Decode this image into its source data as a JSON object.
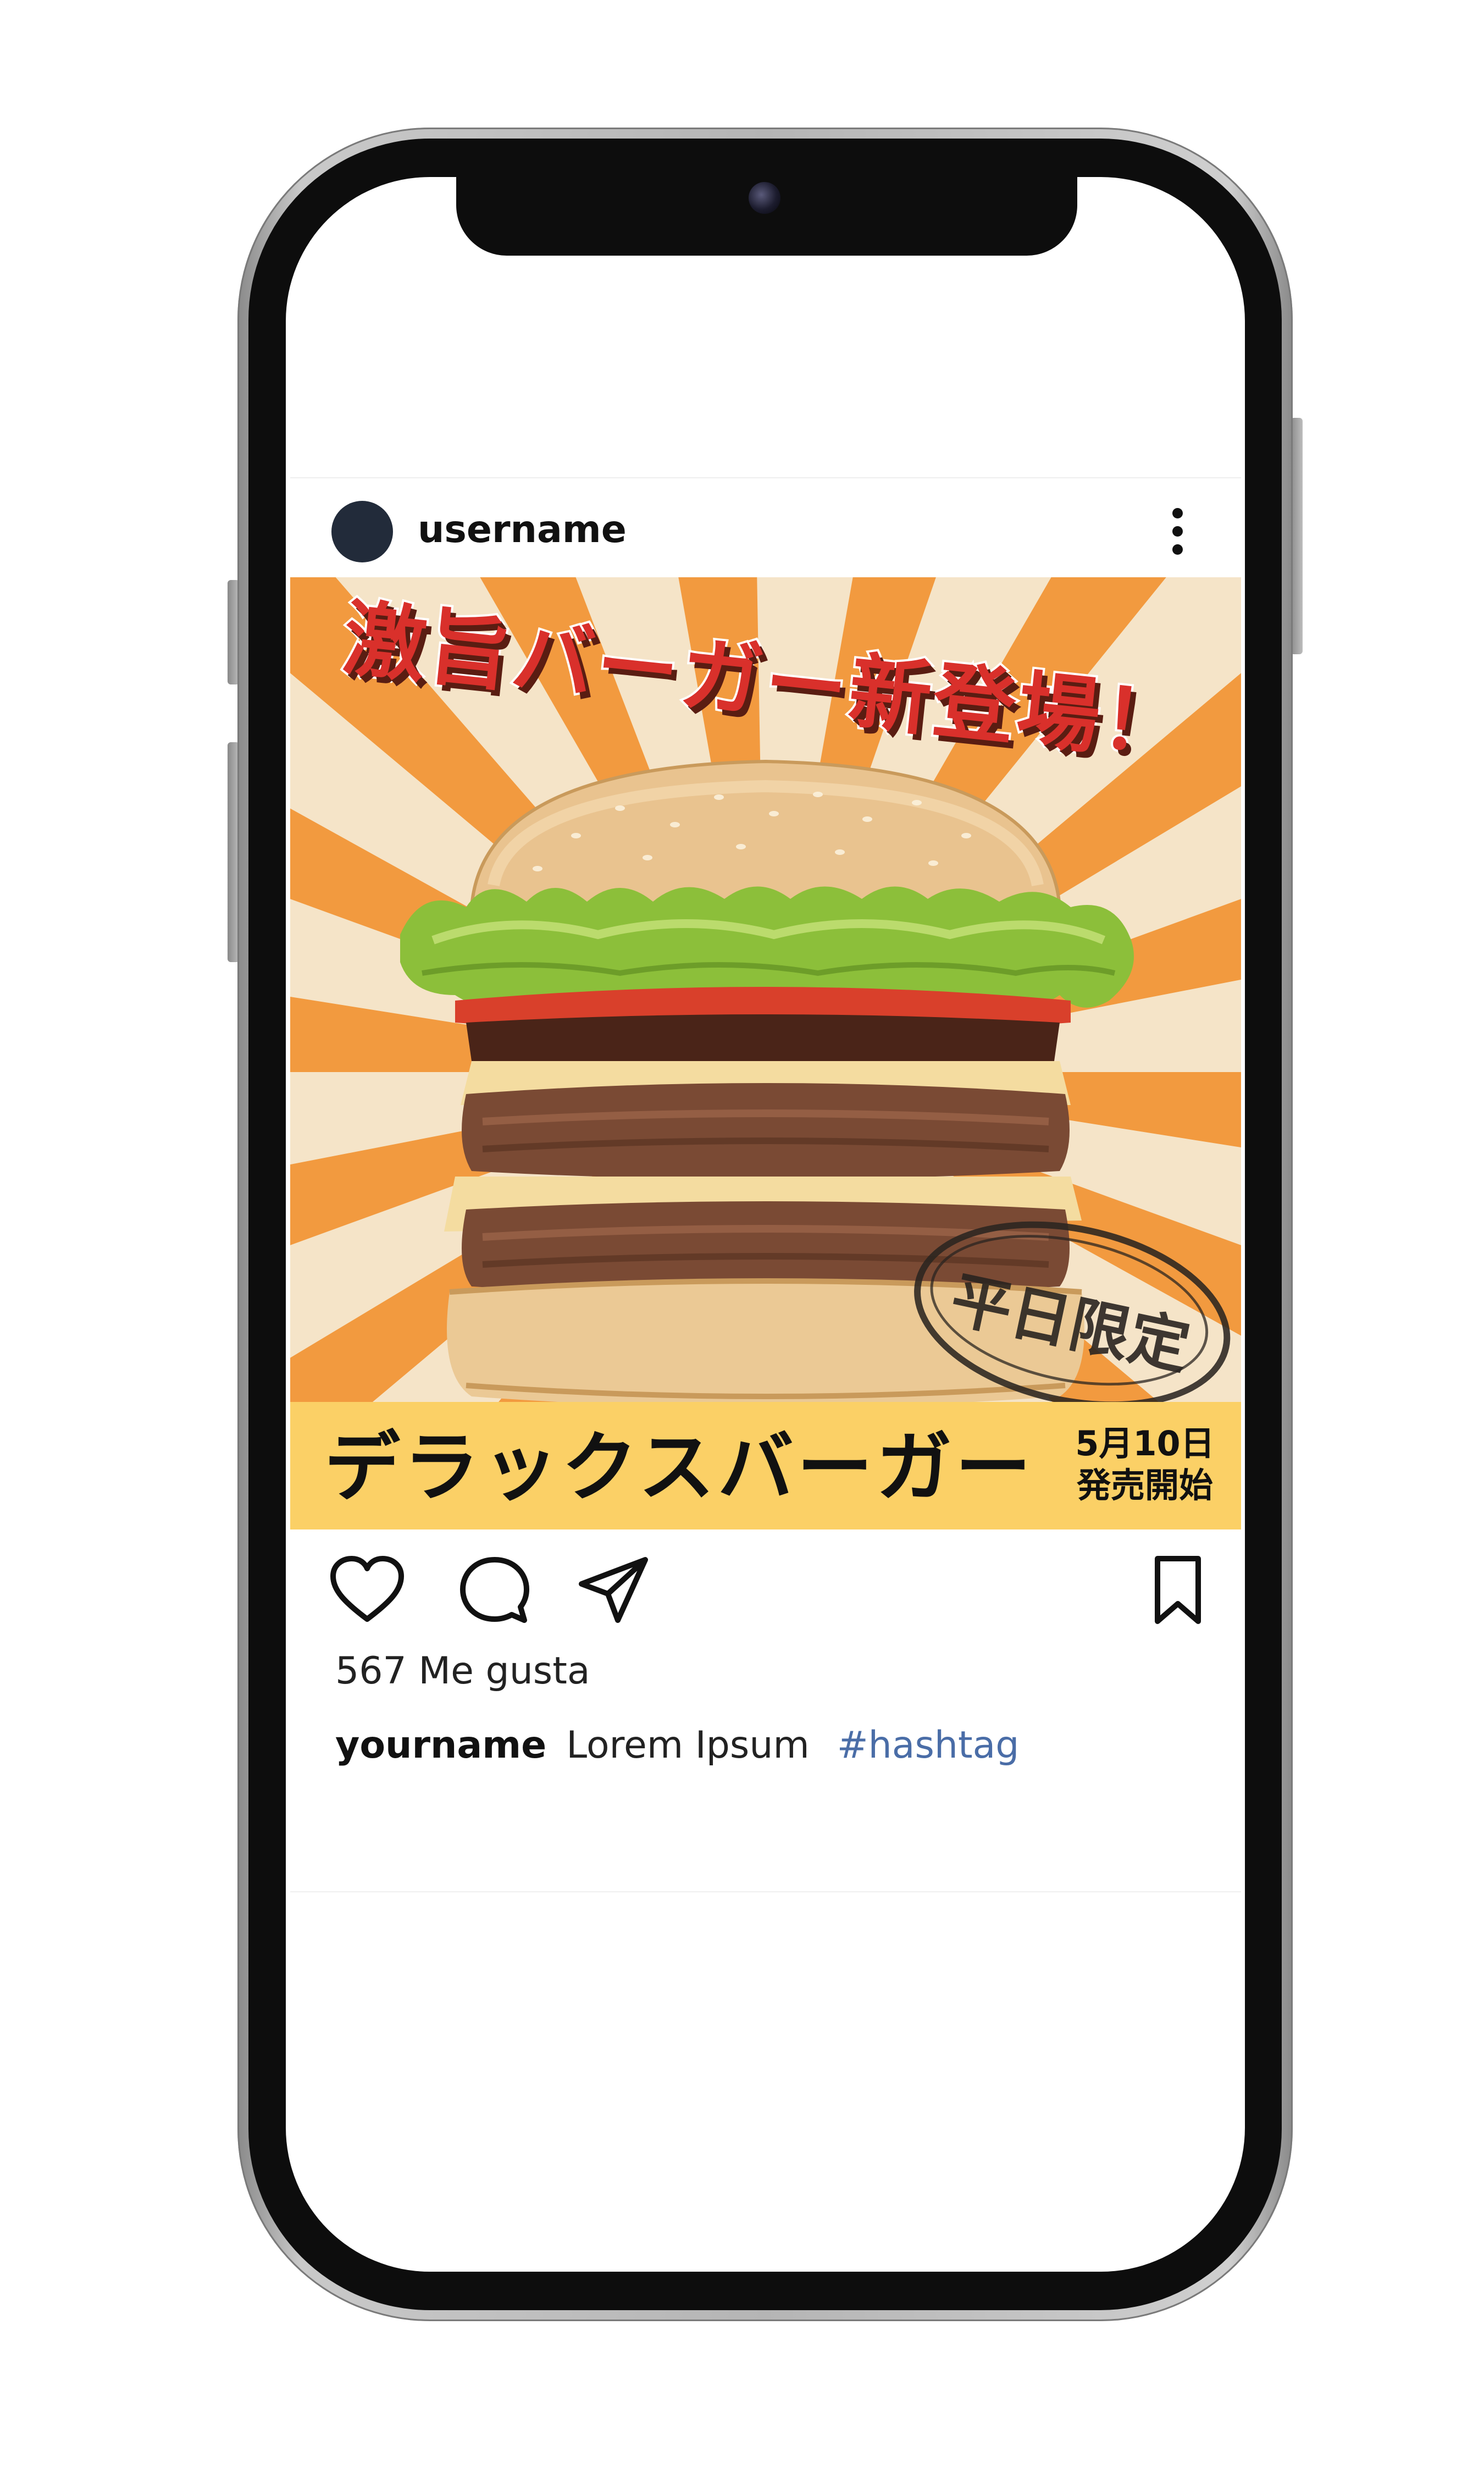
{
  "post": {
    "username": "username",
    "headline": "激旨バーガー新登場！",
    "stamp_text": "平日限定",
    "product_name": "デラックスバーガー",
    "release_date": "5月10日",
    "release_label": "発売開始",
    "likes_text": "567 Me gusta",
    "caption_user": "yourname",
    "caption_text": "Lorem Ipsum",
    "caption_hashtag": "#hashtag"
  },
  "icons": {
    "more": "more-vertical-icon",
    "like": "heart-icon",
    "comment": "comment-icon",
    "share": "send-icon",
    "save": "bookmark-icon"
  },
  "colors": {
    "headline": "#d9302b",
    "banner": "#fbd066",
    "sunburst_ray": "#f29a3f",
    "sunburst_bg": "#f5e4c8",
    "hashtag": "#4a6da7",
    "avatar": "#222b3a"
  }
}
